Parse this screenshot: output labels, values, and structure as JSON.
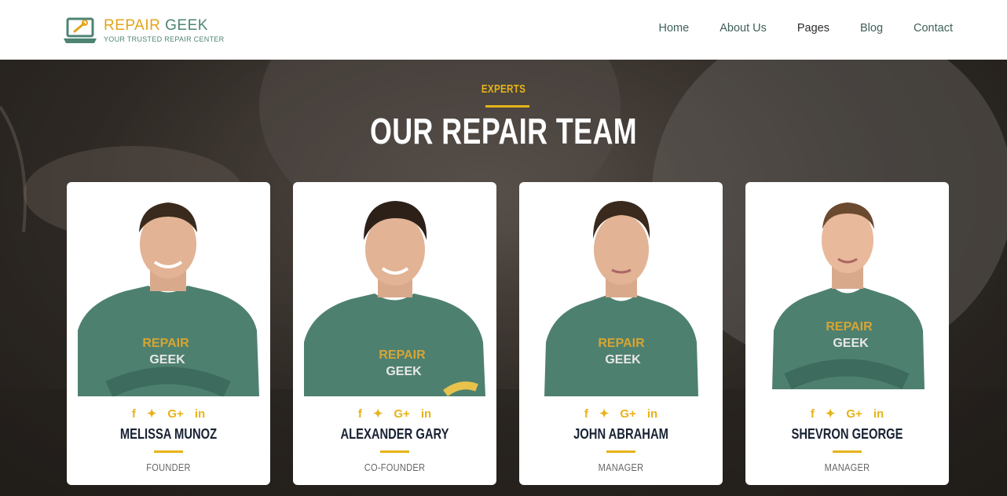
{
  "brand": {
    "name_part1": "REPAIR",
    "name_part2": "GEEK",
    "tagline": "YOUR TRUSTED REPAIR CENTER"
  },
  "nav": [
    "Home",
    "About Us",
    "Pages",
    "Blog",
    "Contact"
  ],
  "section": {
    "kicker": "EXPERTS",
    "title": "OUR REPAIR TEAM"
  },
  "shirt_text": {
    "line1": "REPAIR",
    "line2": "GEEK"
  },
  "team": [
    {
      "name": "MELISSA MUNOZ",
      "role": "FOUNDER"
    },
    {
      "name": "ALEXANDER GARY",
      "role": "CO-FOUNDER"
    },
    {
      "name": "JOHN ABRAHAM",
      "role": "MANAGER"
    },
    {
      "name": "SHEVRON GEORGE",
      "role": "MANAGER"
    }
  ],
  "social_icons": [
    {
      "name": "facebook-icon",
      "glyph": "f"
    },
    {
      "name": "twitter-icon",
      "glyph": "🐦"
    },
    {
      "name": "google-plus-icon",
      "glyph": "G+"
    },
    {
      "name": "linkedin-icon",
      "glyph": "in"
    }
  ],
  "colors": {
    "accent": "#e7b319",
    "brand_green": "#4d8474",
    "shirt": "#4e8070",
    "heading_dark": "#182233"
  }
}
